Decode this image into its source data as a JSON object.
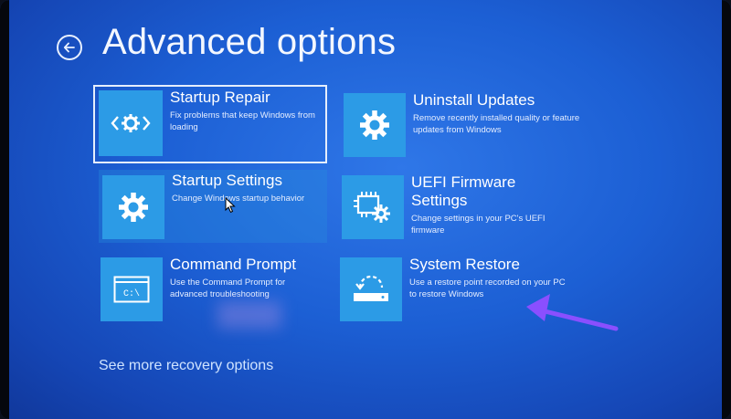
{
  "page": {
    "title": "Advanced options",
    "back_label": "Back"
  },
  "options": [
    {
      "title": "Startup Repair",
      "description": "Fix problems that keep Windows from loading",
      "icon": "startup-repair-icon",
      "selected": true
    },
    {
      "title": "Uninstall Updates",
      "description": "Remove recently installed quality or feature updates from Windows",
      "icon": "gear-icon"
    },
    {
      "title": "Startup Settings",
      "description": "Change Windows startup behavior",
      "icon": "gear-icon"
    },
    {
      "title": "UEFI Firmware Settings",
      "description": "Change settings in your PC's UEFI firmware",
      "icon": "chip-gear-icon"
    },
    {
      "title": "Command Prompt",
      "description": "Use the Command Prompt for advanced troubleshooting",
      "icon": "command-prompt-icon",
      "icon_text": "C:\\"
    },
    {
      "title": "System Restore",
      "description": "Use a restore point recorded on your PC to restore Windows",
      "icon": "system-restore-icon"
    }
  ],
  "footer": {
    "more_link": "See more recovery options"
  },
  "colors": {
    "background": "#1c5fd4",
    "tile": "#2c9be6",
    "annotation_arrow": "#8a4fff"
  }
}
